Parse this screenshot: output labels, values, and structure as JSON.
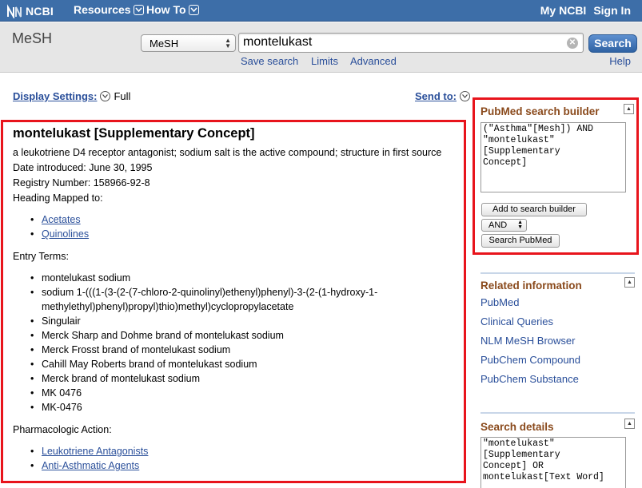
{
  "topbar": {
    "logo_text": "NCBI",
    "nav": [
      {
        "label": "Resources"
      },
      {
        "label": "How To"
      }
    ],
    "my_ncbi": "My NCBI",
    "sign_in": "Sign In",
    "bg_color": "#3d6ea8"
  },
  "search": {
    "db_title": "MeSH",
    "db_selected": "MeSH",
    "query": "montelukast",
    "search_button": "Search",
    "links": [
      "Save search",
      "Limits",
      "Advanced"
    ],
    "help": "Help"
  },
  "display": {
    "settings_label": "Display Settings:",
    "mode": "Full",
    "send_to": "Send to:"
  },
  "record": {
    "title": "montelukast [Supplementary Concept]",
    "description": "a leukotriene D4 receptor antagonist; sodium salt is the active compound; structure in first source",
    "date_introduced": "Date introduced: June 30, 1995",
    "registry_number": "Registry Number: 158966-92-8",
    "heading_mapped_label": "Heading Mapped to:",
    "headings": [
      "Acetates",
      "Quinolines"
    ],
    "entry_terms_label": "Entry Terms:",
    "entry_terms": [
      "montelukast sodium",
      "sodium 1-(((1-(3-(2-(7-chloro-2-quinolinyl)ethenyl)phenyl)-3-(2-(1-hydroxy-1-methylethyl)phenyl)propyl)thio)methyl)cyclopropylacetate",
      "Singulair",
      "Merck Sharp and Dohme brand of montelukast sodium",
      "Merck Frosst brand of montelukast sodium",
      "Cahill May Roberts brand of montelukast sodium",
      "Merck brand of montelukast sodium",
      "MK 0476",
      "MK-0476"
    ],
    "pharm_action_label": "Pharmacologic Action:",
    "pharm_actions": [
      "Leukotriene Antagonists",
      "Anti-Asthmatic Agents"
    ]
  },
  "builder": {
    "title": "PubMed search builder",
    "text": "(\"Asthma\"[Mesh]) AND\n\"montelukast\"\n[Supplementary\nConcept]",
    "add_button": "Add to search builder",
    "operator": "AND",
    "search_button": "Search PubMed"
  },
  "related": {
    "title": "Related information",
    "items": [
      "PubMed",
      "Clinical Queries",
      "NLM MeSH Browser",
      "PubChem Compound",
      "PubChem Substance"
    ]
  },
  "search_details": {
    "title": "Search details",
    "text": "\"montelukast\"\n[Supplementary\nConcept] OR\nmontelukast[Text Word]"
  },
  "colors": {
    "highlight_border": "#e8141c",
    "link": "#2a4f9a",
    "section_title": "#8a4a1c"
  }
}
